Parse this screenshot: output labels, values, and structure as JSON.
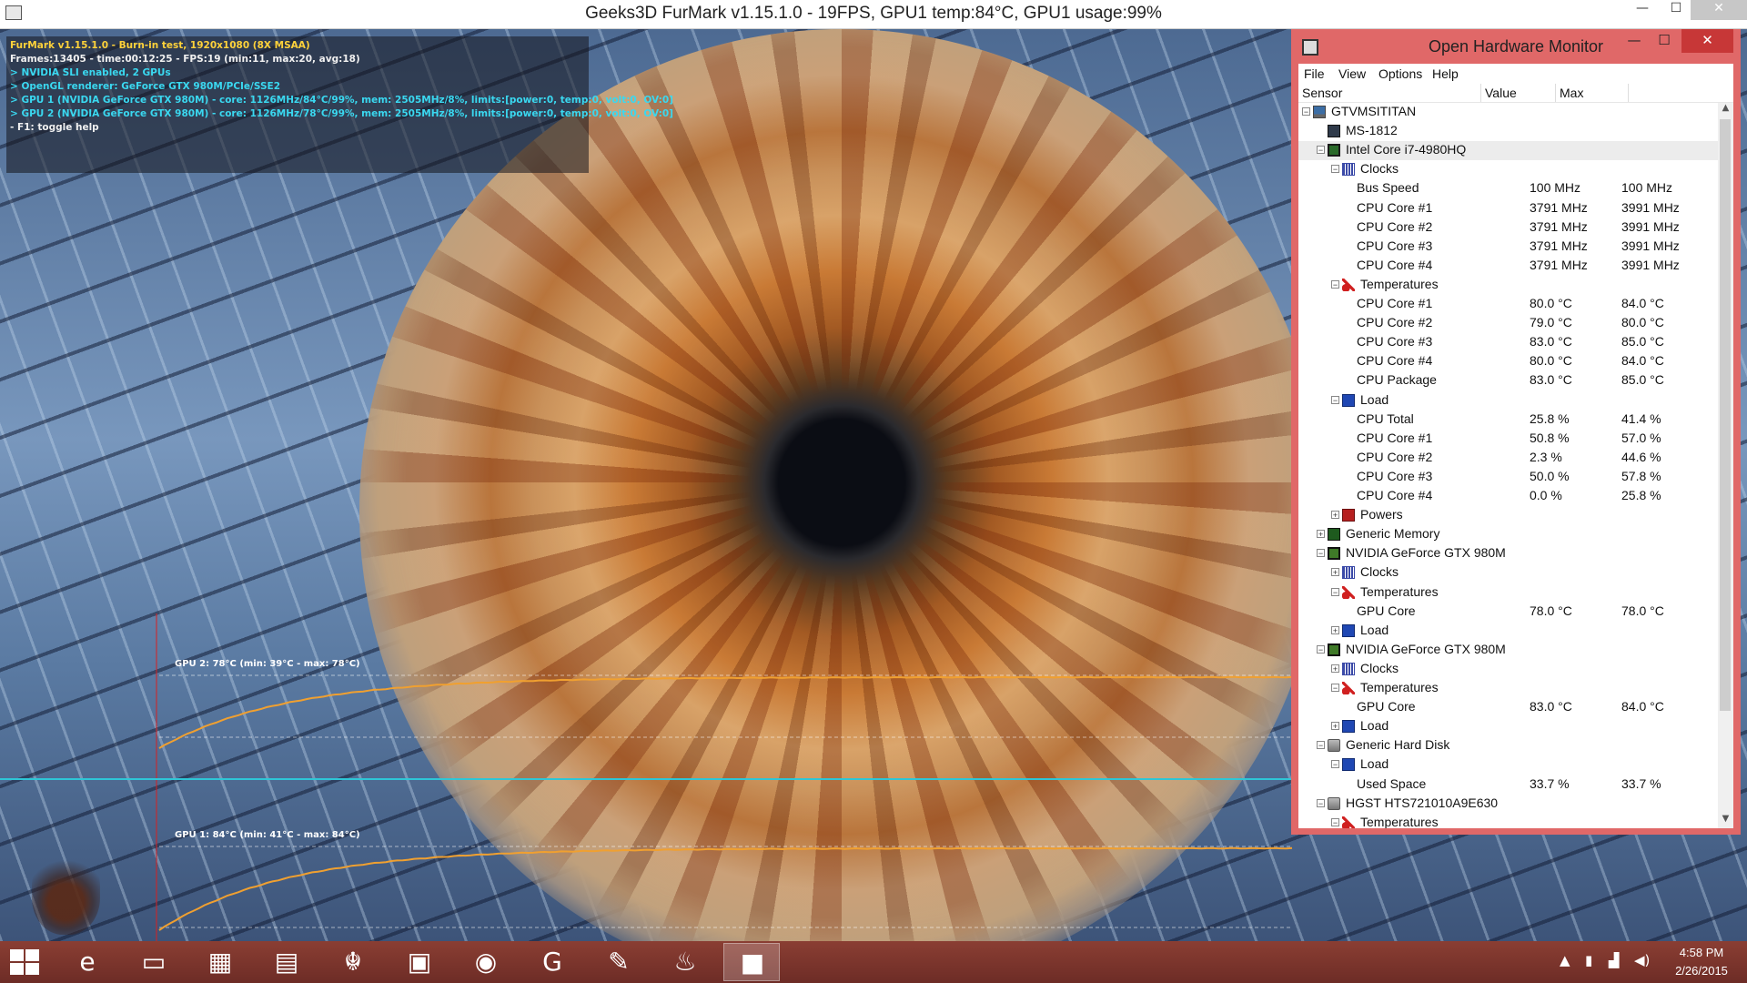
{
  "furmark": {
    "window_title": "Geeks3D FurMark v1.15.1.0 - 19FPS, GPU1 temp:84°C, GPU1 usage:99%",
    "hud": [
      {
        "text": "FurMark v1.15.1.0 - Burn-in test, 1920x1080 (8X MSAA)",
        "color": "yellow"
      },
      {
        "text": "Frames:13405 - time:00:12:25 - FPS:19 (min:11, max:20, avg:18)",
        "color": "white"
      },
      {
        "text": "> NVIDIA SLI enabled, 2 GPUs",
        "color": "cyan"
      },
      {
        "text": "> OpenGL renderer: GeForce GTX 980M/PCIe/SSE2",
        "color": "cyan"
      },
      {
        "text": "> GPU 1 (NVIDIA GeForce GTX 980M) - core: 1126MHz/84°C/99%, mem: 2505MHz/8%, limits:[power:0, temp:0, volt:0, OV:0]",
        "color": "cyan"
      },
      {
        "text": "> GPU 2 (NVIDIA GeForce GTX 980M) - core: 1126MHz/78°C/99%, mem: 2505MHz/8%, limits:[power:0, temp:0, volt:0, OV:0]",
        "color": "cyan"
      },
      {
        "text": "- F1: toggle help",
        "color": "white"
      }
    ],
    "gpu2_graph_label": "GPU 2: 78°C (min: 39°C - max: 78°C)",
    "gpu1_graph_label": "GPU 1: 84°C (min: 41°C - max: 84°C)",
    "gpu2_temp": {
      "min": 39,
      "current": 78,
      "max": 78
    },
    "gpu1_temp": {
      "min": 41,
      "current": 84,
      "max": 84
    },
    "curve_color": "#f0a030"
  },
  "ohm": {
    "title": "Open Hardware Monitor",
    "menu": [
      "File",
      "View",
      "Options",
      "Help"
    ],
    "columns": {
      "sensor": "Sensor",
      "value": "Value",
      "max": "Max"
    },
    "accent": "#e06868",
    "rows": [
      {
        "label": "GTVMSITITAN",
        "value": "",
        "max": "",
        "level": 0,
        "icon": "computer-icon",
        "exp": "−"
      },
      {
        "label": "MS-1812",
        "value": "",
        "max": "",
        "level": 1,
        "icon": "motherboard-icon",
        "exp": ""
      },
      {
        "label": "Intel Core i7-4980HQ",
        "value": "",
        "max": "",
        "level": 1,
        "icon": "cpu-icon",
        "exp": "−",
        "selected": true
      },
      {
        "label": "Clocks",
        "value": "",
        "max": "",
        "level": 2,
        "icon": "clock-icon",
        "exp": "−"
      },
      {
        "label": "Bus Speed",
        "value": "100 MHz",
        "max": "100 MHz",
        "level": 3,
        "icon": "",
        "exp": ""
      },
      {
        "label": "CPU Core #1",
        "value": "3791 MHz",
        "max": "3991 MHz",
        "level": 3,
        "icon": "",
        "exp": ""
      },
      {
        "label": "CPU Core #2",
        "value": "3791 MHz",
        "max": "3991 MHz",
        "level": 3,
        "icon": "",
        "exp": ""
      },
      {
        "label": "CPU Core #3",
        "value": "3791 MHz",
        "max": "3991 MHz",
        "level": 3,
        "icon": "",
        "exp": ""
      },
      {
        "label": "CPU Core #4",
        "value": "3791 MHz",
        "max": "3991 MHz",
        "level": 3,
        "icon": "",
        "exp": ""
      },
      {
        "label": "Temperatures",
        "value": "",
        "max": "",
        "level": 2,
        "icon": "thermometer-icon",
        "exp": "−"
      },
      {
        "label": "CPU Core #1",
        "value": "80.0 °C",
        "max": "84.0 °C",
        "level": 3,
        "icon": "",
        "exp": ""
      },
      {
        "label": "CPU Core #2",
        "value": "79.0 °C",
        "max": "80.0 °C",
        "level": 3,
        "icon": "",
        "exp": ""
      },
      {
        "label": "CPU Core #3",
        "value": "83.0 °C",
        "max": "85.0 °C",
        "level": 3,
        "icon": "",
        "exp": ""
      },
      {
        "label": "CPU Core #4",
        "value": "80.0 °C",
        "max": "84.0 °C",
        "level": 3,
        "icon": "",
        "exp": ""
      },
      {
        "label": "CPU Package",
        "value": "83.0 °C",
        "max": "85.0 °C",
        "level": 3,
        "icon": "",
        "exp": ""
      },
      {
        "label": "Load",
        "value": "",
        "max": "",
        "level": 2,
        "icon": "load-icon",
        "exp": "−"
      },
      {
        "label": "CPU Total",
        "value": "25.8 %",
        "max": "41.4 %",
        "level": 3,
        "icon": "",
        "exp": ""
      },
      {
        "label": "CPU Core #1",
        "value": "50.8 %",
        "max": "57.0 %",
        "level": 3,
        "icon": "",
        "exp": ""
      },
      {
        "label": "CPU Core #2",
        "value": "2.3 %",
        "max": "44.6 %",
        "level": 3,
        "icon": "",
        "exp": ""
      },
      {
        "label": "CPU Core #3",
        "value": "50.0 %",
        "max": "57.8 %",
        "level": 3,
        "icon": "",
        "exp": ""
      },
      {
        "label": "CPU Core #4",
        "value": "0.0 %",
        "max": "25.8 %",
        "level": 3,
        "icon": "",
        "exp": ""
      },
      {
        "label": "Powers",
        "value": "",
        "max": "",
        "level": 2,
        "icon": "power-icon",
        "exp": "+"
      },
      {
        "label": "Generic Memory",
        "value": "",
        "max": "",
        "level": 1,
        "icon": "memory-icon",
        "exp": "+"
      },
      {
        "label": "NVIDIA GeForce GTX 980M",
        "value": "",
        "max": "",
        "level": 1,
        "icon": "gpu-icon",
        "exp": "−"
      },
      {
        "label": "Clocks",
        "value": "",
        "max": "",
        "level": 2,
        "icon": "clock-icon",
        "exp": "+"
      },
      {
        "label": "Temperatures",
        "value": "",
        "max": "",
        "level": 2,
        "icon": "thermometer-icon",
        "exp": "−"
      },
      {
        "label": "GPU Core",
        "value": "78.0 °C",
        "max": "78.0 °C",
        "level": 3,
        "icon": "",
        "exp": ""
      },
      {
        "label": "Load",
        "value": "",
        "max": "",
        "level": 2,
        "icon": "load-icon",
        "exp": "+"
      },
      {
        "label": "NVIDIA GeForce GTX 980M",
        "value": "",
        "max": "",
        "level": 1,
        "icon": "gpu-icon",
        "exp": "−"
      },
      {
        "label": "Clocks",
        "value": "",
        "max": "",
        "level": 2,
        "icon": "clock-icon",
        "exp": "+"
      },
      {
        "label": "Temperatures",
        "value": "",
        "max": "",
        "level": 2,
        "icon": "thermometer-icon",
        "exp": "−"
      },
      {
        "label": "GPU Core",
        "value": "83.0 °C",
        "max": "84.0 °C",
        "level": 3,
        "icon": "",
        "exp": ""
      },
      {
        "label": "Load",
        "value": "",
        "max": "",
        "level": 2,
        "icon": "load-icon",
        "exp": "+"
      },
      {
        "label": "Generic Hard Disk",
        "value": "",
        "max": "",
        "level": 1,
        "icon": "disk-icon",
        "exp": "−"
      },
      {
        "label": "Load",
        "value": "",
        "max": "",
        "level": 2,
        "icon": "load-icon",
        "exp": "−"
      },
      {
        "label": "Used Space",
        "value": "33.7 %",
        "max": "33.7 %",
        "level": 3,
        "icon": "",
        "exp": ""
      },
      {
        "label": "HGST HTS721010A9E630",
        "value": "",
        "max": "",
        "level": 1,
        "icon": "disk-icon",
        "exp": "−"
      },
      {
        "label": "Temperatures",
        "value": "",
        "max": "",
        "level": 2,
        "icon": "thermometer-icon",
        "exp": "−"
      }
    ]
  },
  "taskbar": {
    "apps": [
      {
        "name": "internet-explorer-icon",
        "glyph": "e"
      },
      {
        "name": "file-explorer-icon",
        "glyph": "▭"
      },
      {
        "name": "store-icon",
        "glyph": "▦"
      },
      {
        "name": "task-manager-icon",
        "glyph": "▤"
      },
      {
        "name": "dragon-center-icon",
        "glyph": "☬"
      },
      {
        "name": "remote-desktop-icon",
        "glyph": "▣"
      },
      {
        "name": "chrome-icon",
        "glyph": "◉"
      },
      {
        "name": "logitech-g-icon",
        "glyph": "G"
      },
      {
        "name": "paint-icon",
        "glyph": "✎"
      },
      {
        "name": "furmark-icon",
        "glyph": "♨"
      },
      {
        "name": "open-hardware-monitor-icon",
        "glyph": "■"
      }
    ],
    "clock_time": "4:58 PM",
    "clock_date": "2/26/2015"
  }
}
